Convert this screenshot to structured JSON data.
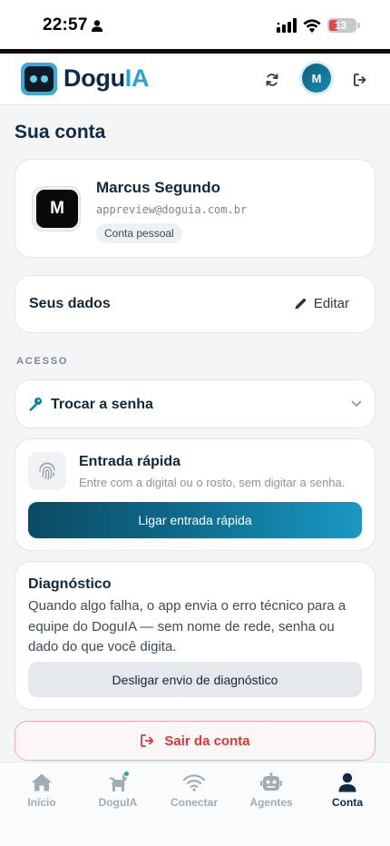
{
  "status_bar": {
    "time": "22:57",
    "battery": "13"
  },
  "header": {
    "brand_main": "Dogu",
    "brand_accent": "IA",
    "avatar_initial": "M"
  },
  "page": {
    "title": "Sua conta"
  },
  "profile": {
    "initial": "M",
    "name": "Marcus Segundo",
    "email": "appreview@doguia.com.br",
    "account_type": "Conta pessoal"
  },
  "your_data": {
    "label": "Seus dados",
    "edit_label": "Editar"
  },
  "access": {
    "section_label": "ACESSO",
    "change_password_label": "Trocar a senha",
    "quick_entry": {
      "title": "Entrada rápida",
      "subtitle": "Entre com a digital ou o rosto, sem digitar a senha.",
      "button": "Ligar entrada rápida"
    }
  },
  "diagnostics": {
    "title": "Diagnóstico",
    "description": "Quando algo falha, o app envia o erro técnico para a equipe do DoguIA — sem nome de rede, senha ou dado do que você digita.",
    "button": "Desligar envio de diagnóstico"
  },
  "logout": {
    "label": "Sair da conta"
  },
  "bottom_nav": [
    {
      "label": "Início",
      "icon": "home-icon",
      "active": false
    },
    {
      "label": "DoguIA",
      "icon": "dog-icon",
      "active": false
    },
    {
      "label": "Conectar",
      "icon": "wifi-icon",
      "active": false
    },
    {
      "label": "Agentes",
      "icon": "robot-icon",
      "active": false
    },
    {
      "label": "Conta",
      "icon": "person-icon",
      "active": true
    }
  ],
  "colors": {
    "brand_dark": "#0f2a44",
    "brand_accent": "#2aa3d6",
    "primary_gradient_start": "#0b4a63",
    "primary_gradient_end": "#1a98c4",
    "danger": "#d5383a",
    "active_dot": "#2ab07f"
  }
}
